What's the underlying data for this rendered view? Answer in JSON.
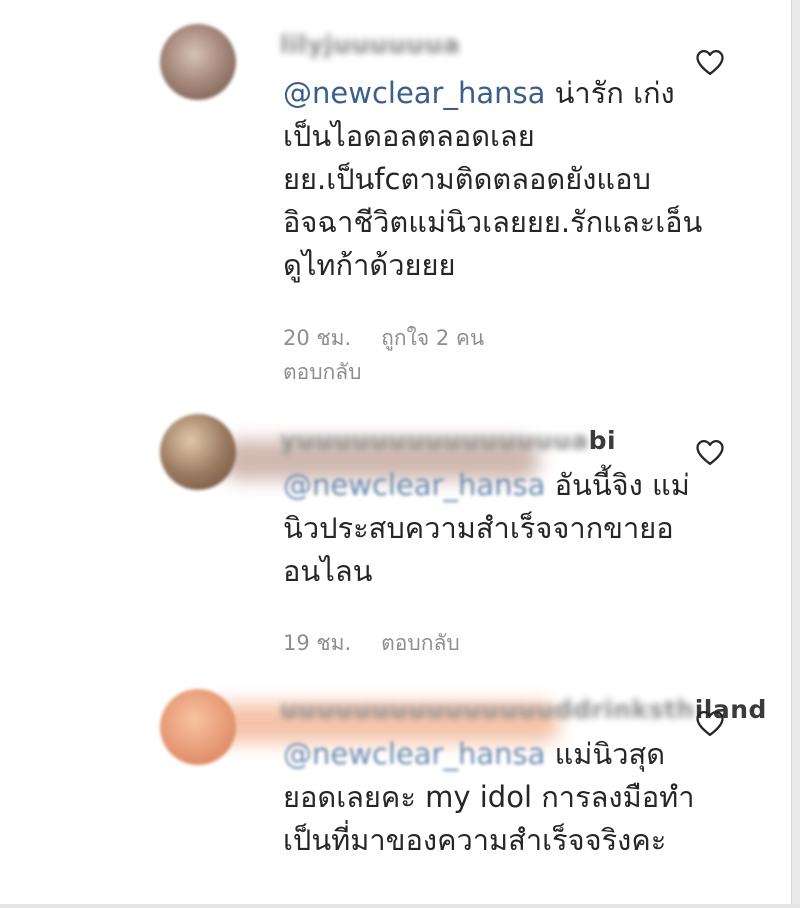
{
  "comments": [
    {
      "username_visible": "",
      "username_blurred": "lilyjuuuuuua",
      "mention": "@newclear_hansa",
      "text": "น่ารัก เก่งเป็นไอดอลตลอดเลยยย.เป็นfcตามติดตลอดยังแอบอิจฉาชีวิตแม่นิวเลยยย.รักและเอ็นดูไทก้าด้วยยย",
      "time": "20 ชม.",
      "likes": "ถูกใจ 2 คน",
      "reply_label": "ตอบกลับ",
      "avatar_color": "#a78a7e",
      "like_icon": "heart-outline-icon"
    },
    {
      "username_visible": "bi",
      "username_blurred": "yuuuuuuuuuuuuuuua",
      "mention": "@newclear_hansa",
      "text": "อันนี้จิง แม่นิวประสบความสำเร็จจากขายออนไลน",
      "time": "19 ชม.",
      "likes": "",
      "reply_label": "ตอบกลับ",
      "avatar_color": "#9c7b62",
      "like_icon": "heart-outline-icon"
    },
    {
      "username_visible": "iland",
      "username_blurred": "uuuuuuuuuuuuuuuddrinksth",
      "mention": "@newclear_hansa",
      "text": "แม่นิวสุดยอดเลยคะ my idol การลงมือทำเป็นที่มาของความสำเร็จจริงคะ",
      "time": "",
      "likes": "",
      "reply_label": "",
      "avatar_color": "#e79a75",
      "like_icon": "heart-outline-icon"
    }
  ]
}
